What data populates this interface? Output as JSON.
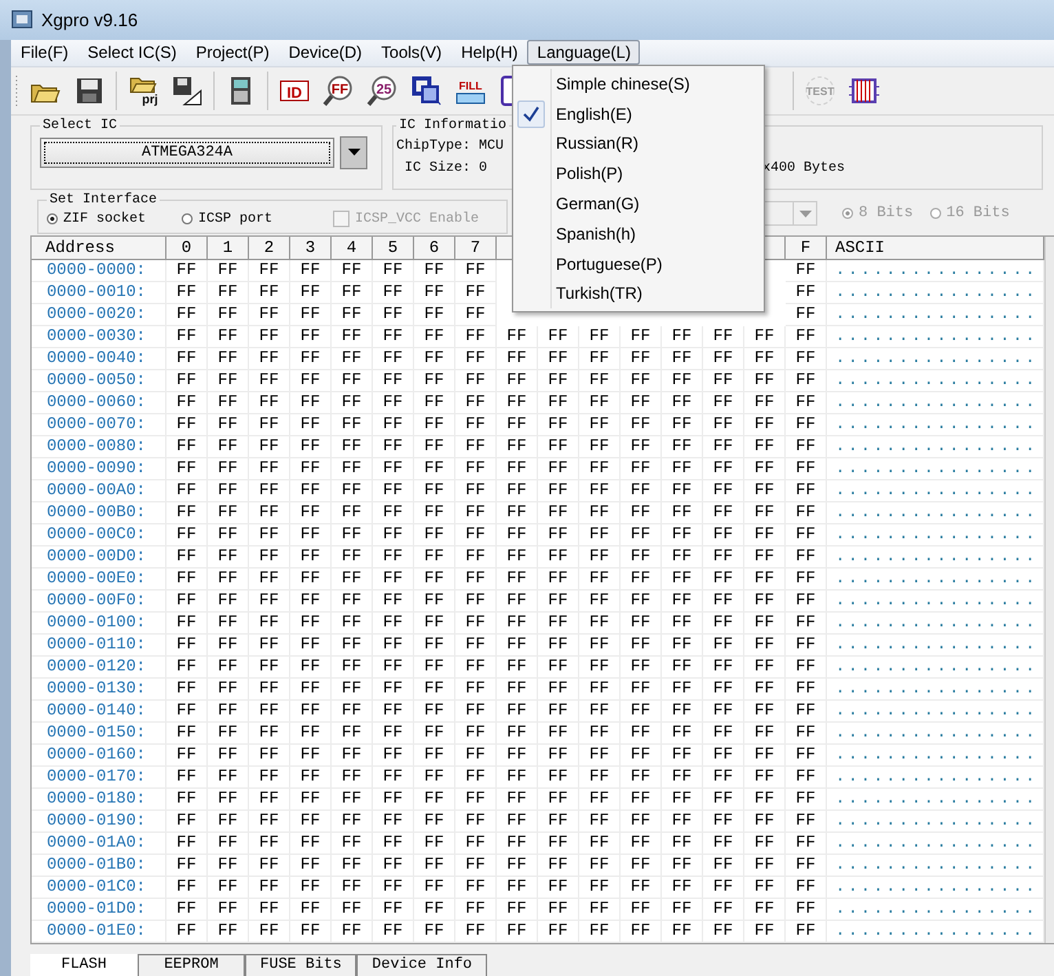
{
  "window": {
    "title": "Xgpro v9.16"
  },
  "menu_bar": [
    {
      "label": "File(F)",
      "selected": false
    },
    {
      "label": "Select IC(S)",
      "selected": false
    },
    {
      "label": "Project(P)",
      "selected": false
    },
    {
      "label": "Device(D)",
      "selected": false
    },
    {
      "label": "Tools(V)",
      "selected": false
    },
    {
      "label": "Help(H)",
      "selected": false
    },
    {
      "label": "Language(L)",
      "selected": true
    }
  ],
  "language_menu": [
    {
      "label": "Simple chinese(S)",
      "checked": false
    },
    {
      "label": "English(E)",
      "checked": true
    },
    {
      "label": "Russian(R)",
      "checked": false
    },
    {
      "label": "Polish(P)",
      "checked": false
    },
    {
      "label": "German(G)",
      "checked": false
    },
    {
      "label": "Spanish(h)",
      "checked": false
    },
    {
      "label": "Portuguese(P)",
      "checked": false
    },
    {
      "label": "Turkish(TR)",
      "checked": false
    }
  ],
  "toolbar": [
    {
      "items": [
        {
          "kind": "open"
        },
        {
          "kind": "save"
        }
      ]
    },
    {
      "items": [
        {
          "kind": "open-project",
          "label": "prj"
        },
        {
          "kind": "save-project"
        }
      ]
    },
    {
      "items": [
        {
          "kind": "device"
        }
      ]
    },
    {
      "items": [
        {
          "kind": "chip-id",
          "label": "ID"
        },
        {
          "kind": "search-ff",
          "label": "FF"
        },
        {
          "kind": "search-25",
          "label": "25"
        },
        {
          "kind": "compare"
        },
        {
          "kind": "fill",
          "label": "FILL"
        },
        {
          "kind": "chip-a"
        }
      ]
    },
    {
      "items": [
        {
          "kind": "test",
          "label": "TEST",
          "disabled": true
        },
        {
          "kind": "chip"
        }
      ]
    }
  ],
  "select_ic": {
    "title": "Select IC",
    "value": "ATMEGA324A"
  },
  "ic_information": {
    "title": "IC Informatio",
    "chip_type_label": "ChipType:",
    "chip_type": "MCU",
    "ic_size_label": "IC Size:",
    "ic_size": "0",
    "ic_size_extra": "x400 Bytes"
  },
  "set_interface": {
    "title": "Set Interface",
    "options": [
      {
        "label": "ZIF socket",
        "selected": true
      },
      {
        "label": "ICSP port",
        "selected": false
      }
    ],
    "icsp_vcc": {
      "label": "ICSP_VCC Enable",
      "checked": false,
      "disabled": true
    }
  },
  "bits": [
    {
      "label": "8 Bits",
      "selected": true,
      "disabled": true
    },
    {
      "label": "16 Bits",
      "selected": false,
      "disabled": true
    }
  ],
  "table": {
    "columns": [
      "Address",
      "0",
      "1",
      "2",
      "3",
      "4",
      "5",
      "6",
      "7",
      null,
      null,
      null,
      null,
      null,
      null,
      null,
      "F",
      "ASCII"
    ],
    "rows": [
      {
        "cells": [
          "0000-0000:",
          "FF",
          "FF",
          "FF",
          "FF",
          "FF",
          "FF",
          "FF",
          "FF",
          null,
          null,
          null,
          null,
          null,
          null,
          null,
          "FF",
          "................"
        ]
      },
      {
        "cells": [
          "0000-0010:",
          "FF",
          "FF",
          "FF",
          "FF",
          "FF",
          "FF",
          "FF",
          "FF",
          null,
          null,
          null,
          null,
          null,
          null,
          null,
          "FF",
          "................"
        ]
      },
      {
        "cells": [
          "0000-0020:",
          "FF",
          "FF",
          "FF",
          "FF",
          "FF",
          "FF",
          "FF",
          "FF",
          null,
          null,
          null,
          null,
          null,
          null,
          null,
          "FF",
          "................"
        ]
      },
      {
        "cells": [
          "0000-0030:",
          "FF",
          "FF",
          "FF",
          "FF",
          "FF",
          "FF",
          "FF",
          "FF",
          "FF",
          "FF",
          "FF",
          "FF",
          "FF",
          "FF",
          "FF",
          "FF",
          "................"
        ]
      },
      {
        "cells": [
          "0000-0040:",
          "FF",
          "FF",
          "FF",
          "FF",
          "FF",
          "FF",
          "FF",
          "FF",
          "FF",
          "FF",
          "FF",
          "FF",
          "FF",
          "FF",
          "FF",
          "FF",
          "................"
        ]
      },
      {
        "cells": [
          "0000-0050:",
          "FF",
          "FF",
          "FF",
          "FF",
          "FF",
          "FF",
          "FF",
          "FF",
          "FF",
          "FF",
          "FF",
          "FF",
          "FF",
          "FF",
          "FF",
          "FF",
          "................"
        ]
      },
      {
        "cells": [
          "0000-0060:",
          "FF",
          "FF",
          "FF",
          "FF",
          "FF",
          "FF",
          "FF",
          "FF",
          "FF",
          "FF",
          "FF",
          "FF",
          "FF",
          "FF",
          "FF",
          "FF",
          "................"
        ]
      },
      {
        "cells": [
          "0000-0070:",
          "FF",
          "FF",
          "FF",
          "FF",
          "FF",
          "FF",
          "FF",
          "FF",
          "FF",
          "FF",
          "FF",
          "FF",
          "FF",
          "FF",
          "FF",
          "FF",
          "................"
        ]
      },
      {
        "cells": [
          "0000-0080:",
          "FF",
          "FF",
          "FF",
          "FF",
          "FF",
          "FF",
          "FF",
          "FF",
          "FF",
          "FF",
          "FF",
          "FF",
          "FF",
          "FF",
          "FF",
          "FF",
          "................"
        ]
      },
      {
        "cells": [
          "0000-0090:",
          "FF",
          "FF",
          "FF",
          "FF",
          "FF",
          "FF",
          "FF",
          "FF",
          "FF",
          "FF",
          "FF",
          "FF",
          "FF",
          "FF",
          "FF",
          "FF",
          "................"
        ]
      },
      {
        "cells": [
          "0000-00A0:",
          "FF",
          "FF",
          "FF",
          "FF",
          "FF",
          "FF",
          "FF",
          "FF",
          "FF",
          "FF",
          "FF",
          "FF",
          "FF",
          "FF",
          "FF",
          "FF",
          "................"
        ]
      },
      {
        "cells": [
          "0000-00B0:",
          "FF",
          "FF",
          "FF",
          "FF",
          "FF",
          "FF",
          "FF",
          "FF",
          "FF",
          "FF",
          "FF",
          "FF",
          "FF",
          "FF",
          "FF",
          "FF",
          "................"
        ]
      },
      {
        "cells": [
          "0000-00C0:",
          "FF",
          "FF",
          "FF",
          "FF",
          "FF",
          "FF",
          "FF",
          "FF",
          "FF",
          "FF",
          "FF",
          "FF",
          "FF",
          "FF",
          "FF",
          "FF",
          "................"
        ]
      },
      {
        "cells": [
          "0000-00D0:",
          "FF",
          "FF",
          "FF",
          "FF",
          "FF",
          "FF",
          "FF",
          "FF",
          "FF",
          "FF",
          "FF",
          "FF",
          "FF",
          "FF",
          "FF",
          "FF",
          "................"
        ]
      },
      {
        "cells": [
          "0000-00E0:",
          "FF",
          "FF",
          "FF",
          "FF",
          "FF",
          "FF",
          "FF",
          "FF",
          "FF",
          "FF",
          "FF",
          "FF",
          "FF",
          "FF",
          "FF",
          "FF",
          "................"
        ]
      },
      {
        "cells": [
          "0000-00F0:",
          "FF",
          "FF",
          "FF",
          "FF",
          "FF",
          "FF",
          "FF",
          "FF",
          "FF",
          "FF",
          "FF",
          "FF",
          "FF",
          "FF",
          "FF",
          "FF",
          "................"
        ]
      },
      {
        "cells": [
          "0000-0100:",
          "FF",
          "FF",
          "FF",
          "FF",
          "FF",
          "FF",
          "FF",
          "FF",
          "FF",
          "FF",
          "FF",
          "FF",
          "FF",
          "FF",
          "FF",
          "FF",
          "................"
        ]
      },
      {
        "cells": [
          "0000-0110:",
          "FF",
          "FF",
          "FF",
          "FF",
          "FF",
          "FF",
          "FF",
          "FF",
          "FF",
          "FF",
          "FF",
          "FF",
          "FF",
          "FF",
          "FF",
          "FF",
          "................"
        ]
      },
      {
        "cells": [
          "0000-0120:",
          "FF",
          "FF",
          "FF",
          "FF",
          "FF",
          "FF",
          "FF",
          "FF",
          "FF",
          "FF",
          "FF",
          "FF",
          "FF",
          "FF",
          "FF",
          "FF",
          "................"
        ]
      },
      {
        "cells": [
          "0000-0130:",
          "FF",
          "FF",
          "FF",
          "FF",
          "FF",
          "FF",
          "FF",
          "FF",
          "FF",
          "FF",
          "FF",
          "FF",
          "FF",
          "FF",
          "FF",
          "FF",
          "................"
        ]
      },
      {
        "cells": [
          "0000-0140:",
          "FF",
          "FF",
          "FF",
          "FF",
          "FF",
          "FF",
          "FF",
          "FF",
          "FF",
          "FF",
          "FF",
          "FF",
          "FF",
          "FF",
          "FF",
          "FF",
          "................"
        ]
      },
      {
        "cells": [
          "0000-0150:",
          "FF",
          "FF",
          "FF",
          "FF",
          "FF",
          "FF",
          "FF",
          "FF",
          "FF",
          "FF",
          "FF",
          "FF",
          "FF",
          "FF",
          "FF",
          "FF",
          "................"
        ]
      },
      {
        "cells": [
          "0000-0160:",
          "FF",
          "FF",
          "FF",
          "FF",
          "FF",
          "FF",
          "FF",
          "FF",
          "FF",
          "FF",
          "FF",
          "FF",
          "FF",
          "FF",
          "FF",
          "FF",
          "................"
        ]
      },
      {
        "cells": [
          "0000-0170:",
          "FF",
          "FF",
          "FF",
          "FF",
          "FF",
          "FF",
          "FF",
          "FF",
          "FF",
          "FF",
          "FF",
          "FF",
          "FF",
          "FF",
          "FF",
          "FF",
          "................"
        ]
      },
      {
        "cells": [
          "0000-0180:",
          "FF",
          "FF",
          "FF",
          "FF",
          "FF",
          "FF",
          "FF",
          "FF",
          "FF",
          "FF",
          "FF",
          "FF",
          "FF",
          "FF",
          "FF",
          "FF",
          "................"
        ]
      },
      {
        "cells": [
          "0000-0190:",
          "FF",
          "FF",
          "FF",
          "FF",
          "FF",
          "FF",
          "FF",
          "FF",
          "FF",
          "FF",
          "FF",
          "FF",
          "FF",
          "FF",
          "FF",
          "FF",
          "................"
        ]
      },
      {
        "cells": [
          "0000-01A0:",
          "FF",
          "FF",
          "FF",
          "FF",
          "FF",
          "FF",
          "FF",
          "FF",
          "FF",
          "FF",
          "FF",
          "FF",
          "FF",
          "FF",
          "FF",
          "FF",
          "................"
        ]
      },
      {
        "cells": [
          "0000-01B0:",
          "FF",
          "FF",
          "FF",
          "FF",
          "FF",
          "FF",
          "FF",
          "FF",
          "FF",
          "FF",
          "FF",
          "FF",
          "FF",
          "FF",
          "FF",
          "FF",
          "................"
        ]
      },
      {
        "cells": [
          "0000-01C0:",
          "FF",
          "FF",
          "FF",
          "FF",
          "FF",
          "FF",
          "FF",
          "FF",
          "FF",
          "FF",
          "FF",
          "FF",
          "FF",
          "FF",
          "FF",
          "FF",
          "................"
        ]
      },
      {
        "cells": [
          "0000-01D0:",
          "FF",
          "FF",
          "FF",
          "FF",
          "FF",
          "FF",
          "FF",
          "FF",
          "FF",
          "FF",
          "FF",
          "FF",
          "FF",
          "FF",
          "FF",
          "FF",
          "................"
        ]
      },
      {
        "cells": [
          "0000-01E0:",
          "FF",
          "FF",
          "FF",
          "FF",
          "FF",
          "FF",
          "FF",
          "FF",
          "FF",
          "FF",
          "FF",
          "FF",
          "FF",
          "FF",
          "FF",
          "FF",
          "................"
        ]
      }
    ]
  },
  "bottom_tabs": [
    {
      "label": "FLASH",
      "selected": true
    },
    {
      "label": "EEPROM",
      "selected": false
    },
    {
      "label": "FUSE Bits",
      "selected": false
    },
    {
      "label": "Device Info",
      "selected": false
    }
  ]
}
